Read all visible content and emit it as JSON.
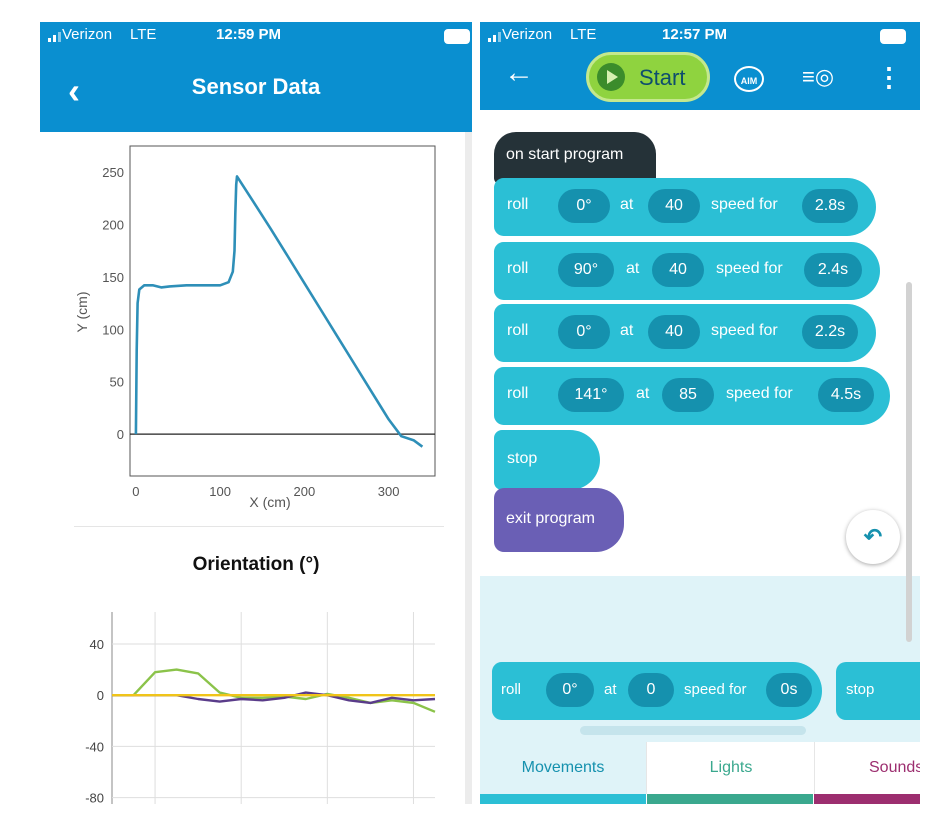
{
  "left_phone": {
    "status": {
      "carrier": "Verizon",
      "network": "LTE",
      "time": "12:59 PM"
    },
    "nav": {
      "back_glyph": "‹",
      "title": "Sensor Data"
    },
    "position_chart": {
      "ylabel": "Y (cm)",
      "xlabel": "X (cm)",
      "y_ticks": [
        "250",
        "200",
        "150",
        "100",
        "50",
        "0"
      ],
      "x_ticks": [
        "0",
        "100",
        "200",
        "300"
      ]
    },
    "orientation_chart": {
      "title": "Orientation (°)",
      "y_ticks": [
        "40",
        "0",
        "-40",
        "-80"
      ]
    }
  },
  "right_phone": {
    "status": {
      "carrier": "Verizon",
      "network": "LTE",
      "time": "12:57 PM"
    },
    "toolbar": {
      "back_glyph": "←",
      "start_label": "Start",
      "aim_label": "AIM",
      "sensor_glyph": "≡◎",
      "menu_glyph": "⋮"
    },
    "program": {
      "start_label": "on start program",
      "rolls": [
        {
          "word": "roll",
          "heading": "0°",
          "at": "at",
          "speed": "40",
          "speed_for": "speed for",
          "duration": "2.8s"
        },
        {
          "word": "roll",
          "heading": "90°",
          "at": "at",
          "speed": "40",
          "speed_for": "speed for",
          "duration": "2.4s"
        },
        {
          "word": "roll",
          "heading": "0°",
          "at": "at",
          "speed": "40",
          "speed_for": "speed for",
          "duration": "2.2s"
        },
        {
          "word": "roll",
          "heading": "141°",
          "at": "at",
          "speed": "85",
          "speed_for": "speed for",
          "duration": "4.5s"
        }
      ],
      "stop_label": "stop",
      "exit_label": "exit program",
      "undo_glyph": "↶"
    },
    "tray": {
      "roll": {
        "word": "roll",
        "heading": "0°",
        "at": "at",
        "speed": "0",
        "speed_for": "speed for",
        "duration": "0s"
      },
      "stop_label": "stop"
    },
    "tabs": [
      {
        "label": "Movements",
        "color": "#2bbfd5"
      },
      {
        "label": "Lights",
        "color": "#3aa88e"
      },
      {
        "label": "Sounds",
        "color": "#9c2e6f"
      }
    ]
  },
  "chart_data": [
    {
      "type": "line",
      "title": "",
      "xlabel": "X (cm)",
      "ylabel": "Y (cm)",
      "xlim": [
        -7,
        355
      ],
      "ylim": [
        -40,
        275
      ],
      "x_ticks": [
        0,
        100,
        200,
        300
      ],
      "y_ticks": [
        0,
        50,
        100,
        150,
        200,
        250
      ],
      "grid": false,
      "series": [
        {
          "color": "#2e8fb8",
          "x": [
            0,
            1,
            2,
            4,
            10,
            20,
            30,
            40,
            60,
            80,
            100,
            110,
            115,
            117,
            118,
            119,
            120,
            140,
            160,
            180,
            200,
            220,
            240,
            260,
            280,
            300,
            315,
            330,
            340
          ],
          "y": [
            0,
            80,
            125,
            138,
            142,
            142,
            140,
            141,
            142,
            142,
            142,
            145,
            155,
            175,
            210,
            238,
            246,
            221,
            196,
            170,
            144,
            118,
            92,
            66,
            40,
            14,
            -2,
            -6,
            -12
          ]
        }
      ]
    },
    {
      "type": "line",
      "title": "Orientation (°)",
      "ylim": [
        -85,
        65
      ],
      "y_ticks": [
        40,
        0,
        -40,
        -80
      ],
      "grid": true,
      "series": [
        {
          "color": "#8bc34a",
          "x": [
            0,
            1,
            2,
            3,
            4,
            5,
            6,
            7,
            8,
            9,
            10,
            11,
            12,
            13,
            14,
            15
          ],
          "y": [
            0,
            0,
            18,
            20,
            17,
            2,
            -2,
            -2,
            -1,
            -3,
            1,
            -2,
            -6,
            -4,
            -6,
            -13
          ]
        },
        {
          "color": "#5a3c8a",
          "x": [
            0,
            1,
            2,
            3,
            4,
            5,
            6,
            7,
            8,
            9,
            10,
            11,
            12,
            13,
            14,
            15
          ],
          "y": [
            0,
            0,
            0,
            0,
            -3,
            -5,
            -3,
            -4,
            -2,
            2,
            0,
            -4,
            -6,
            -2,
            -4,
            -3
          ]
        },
        {
          "color": "#f0c419",
          "x": [
            0,
            15
          ],
          "y": [
            0,
            0
          ]
        }
      ]
    }
  ]
}
